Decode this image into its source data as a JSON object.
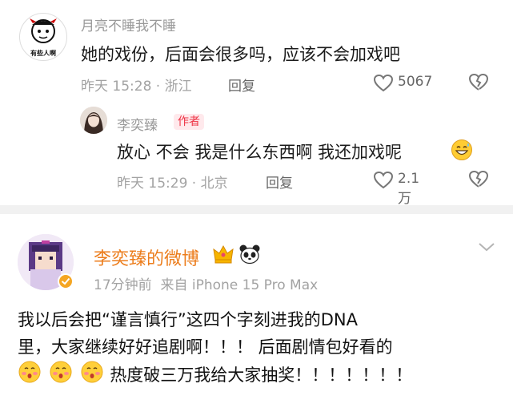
{
  "comment1": {
    "avatar_caption": "有些人啊",
    "username": "月亮不睡我不睡",
    "text": "她的戏份，后面会很多吗，应该不会加戏吧",
    "time": "昨天 15:28 · 浙江",
    "reply_label": "回复",
    "like_count": "5067"
  },
  "reply1": {
    "username": "李奕臻",
    "badge": "作者",
    "text": "放心 不会 我是什么东西啊 我还加戏呢",
    "time": "昨天 15:29 · 北京",
    "reply_label": "回复",
    "like_count": "2.1万"
  },
  "weibo": {
    "name": "李奕臻的微博",
    "time_source": "17分钟前  来自 iPhone 15 Pro Max",
    "line1": "我以后会把“谨言慎行”这四个字刻进我的DNA",
    "line2": "里，大家继续好好追剧啊！！！ 后面剧情包好看的",
    "line3": "热度破三万我给大家抽奖！！！！！！！"
  },
  "colors": {
    "accent_orange": "#ec7d1c",
    "author_red": "#ee3344",
    "divider": "#f1f1f1"
  }
}
